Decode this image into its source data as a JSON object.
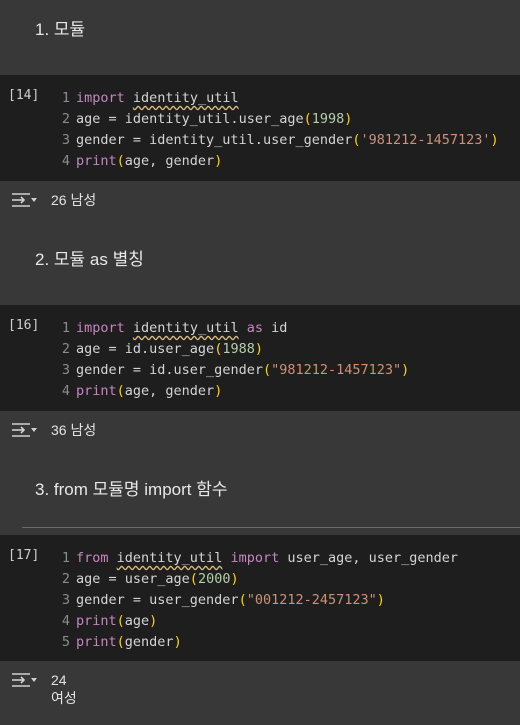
{
  "sections": [
    {
      "heading": "1. 모듈"
    },
    {
      "heading": "2. 모듈 as 별칭"
    },
    {
      "heading": "3. from 모듈명 import 함수"
    }
  ],
  "cells": [
    {
      "exec_count": "[14]",
      "lines": [
        {
          "num": "1",
          "tokens": [
            {
              "t": "import",
              "c": "kw"
            },
            {
              "t": " ",
              "c": "id"
            },
            {
              "t": "identity_util",
              "c": "id sq"
            }
          ]
        },
        {
          "num": "2",
          "tokens": [
            {
              "t": "age = identity_util.",
              "c": "id"
            },
            {
              "t": "user_age",
              "c": "id"
            },
            {
              "t": "(",
              "c": "pn"
            },
            {
              "t": "1998",
              "c": "nm"
            },
            {
              "t": ")",
              "c": "pn"
            }
          ]
        },
        {
          "num": "3",
          "tokens": [
            {
              "t": "gender = identity_util.",
              "c": "id"
            },
            {
              "t": "user_gender",
              "c": "id"
            },
            {
              "t": "(",
              "c": "pn"
            },
            {
              "t": "'981212-1457123'",
              "c": "str"
            },
            {
              "t": ")",
              "c": "pn"
            }
          ]
        },
        {
          "num": "4",
          "tokens": [
            {
              "t": "print",
              "c": "kw"
            },
            {
              "t": "(",
              "c": "pn"
            },
            {
              "t": "age, gender",
              "c": "id"
            },
            {
              "t": ")",
              "c": "pn"
            }
          ]
        }
      ],
      "output": [
        "26 남성"
      ]
    },
    {
      "exec_count": "[16]",
      "lines": [
        {
          "num": "1",
          "tokens": [
            {
              "t": "import",
              "c": "kw"
            },
            {
              "t": " ",
              "c": "id"
            },
            {
              "t": "identity_util",
              "c": "id sq"
            },
            {
              "t": " ",
              "c": "id"
            },
            {
              "t": "as",
              "c": "kw"
            },
            {
              "t": " id",
              "c": "id"
            }
          ]
        },
        {
          "num": "2",
          "tokens": [
            {
              "t": "age = id.",
              "c": "id"
            },
            {
              "t": "user_age",
              "c": "id"
            },
            {
              "t": "(",
              "c": "pn"
            },
            {
              "t": "1988",
              "c": "nm"
            },
            {
              "t": ")",
              "c": "pn"
            }
          ]
        },
        {
          "num": "3",
          "tokens": [
            {
              "t": "gender = id.",
              "c": "id"
            },
            {
              "t": "user_gender",
              "c": "id"
            },
            {
              "t": "(",
              "c": "pn"
            },
            {
              "t": "\"981212-1457123\"",
              "c": "str"
            },
            {
              "t": ")",
              "c": "pn"
            }
          ]
        },
        {
          "num": "4",
          "tokens": [
            {
              "t": "print",
              "c": "kw"
            },
            {
              "t": "(",
              "c": "pn"
            },
            {
              "t": "age, gender",
              "c": "id"
            },
            {
              "t": ")",
              "c": "pn"
            }
          ]
        }
      ],
      "output": [
        "36 남성"
      ]
    },
    {
      "exec_count": "[17]",
      "lines": [
        {
          "num": "1",
          "tokens": [
            {
              "t": "from",
              "c": "kw"
            },
            {
              "t": " ",
              "c": "id"
            },
            {
              "t": "identity_util",
              "c": "id sq"
            },
            {
              "t": " ",
              "c": "id"
            },
            {
              "t": "import",
              "c": "kw"
            },
            {
              "t": " user_age, user_gender",
              "c": "id"
            }
          ]
        },
        {
          "num": "2",
          "tokens": [
            {
              "t": "age = user_age",
              "c": "id"
            },
            {
              "t": "(",
              "c": "pn"
            },
            {
              "t": "2000",
              "c": "nm"
            },
            {
              "t": ")",
              "c": "pn"
            }
          ]
        },
        {
          "num": "3",
          "tokens": [
            {
              "t": "gender = user_gender",
              "c": "id"
            },
            {
              "t": "(",
              "c": "pn"
            },
            {
              "t": "\"001212-2457123\"",
              "c": "str"
            },
            {
              "t": ")",
              "c": "pn"
            }
          ]
        },
        {
          "num": "4",
          "tokens": [
            {
              "t": "print",
              "c": "kw"
            },
            {
              "t": "(",
              "c": "pn"
            },
            {
              "t": "age",
              "c": "id"
            },
            {
              "t": ")",
              "c": "pn"
            }
          ]
        },
        {
          "num": "5",
          "tokens": [
            {
              "t": "print",
              "c": "kw"
            },
            {
              "t": "(",
              "c": "pn"
            },
            {
              "t": "gender",
              "c": "id"
            },
            {
              "t": ")",
              "c": "pn"
            }
          ]
        }
      ],
      "output": [
        "24",
        "여성"
      ]
    }
  ],
  "icons": {
    "output_toggle": "output-toggle-icon"
  }
}
